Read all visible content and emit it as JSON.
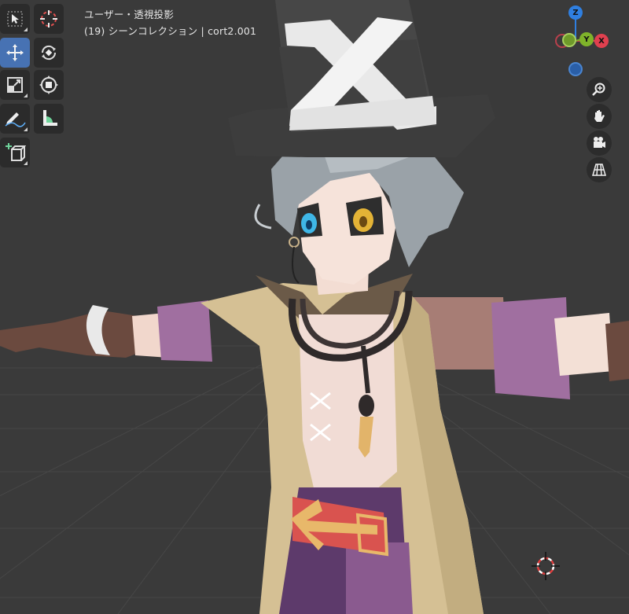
{
  "viewport": {
    "title": "ユーザー・透視投影",
    "subtitle": "(19) シーンコレクション | cort2.001"
  },
  "toolbar": {
    "tools": [
      {
        "name": "select-box",
        "active": false
      },
      {
        "name": "cursor",
        "active": false
      },
      {
        "name": "move",
        "active": true
      },
      {
        "name": "rotate",
        "active": false
      },
      {
        "name": "scale",
        "active": false
      },
      {
        "name": "transform",
        "active": false
      },
      {
        "name": "annotate",
        "active": false
      },
      {
        "name": "measure",
        "active": false
      },
      {
        "name": "add-cube",
        "active": false
      }
    ]
  },
  "gizmo": {
    "axes": {
      "x": "X",
      "y": "Y",
      "z": "Z"
    },
    "colors": {
      "x": "#e0404f",
      "y": "#7fb32a",
      "z": "#2f7fe0"
    }
  },
  "nav_buttons": [
    "zoom",
    "pan",
    "camera",
    "perspective-grid"
  ],
  "colors": {
    "background": "#3a3a3a",
    "grid": "#444444",
    "active_tool": "#4772b3",
    "tool_bg": "#2b2b2b"
  }
}
